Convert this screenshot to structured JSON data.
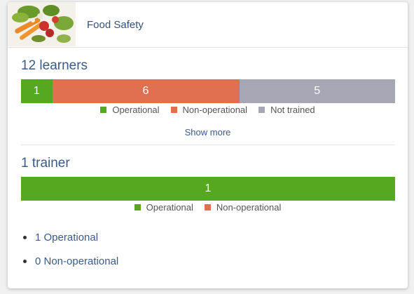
{
  "header": {
    "title": "Food Safety",
    "thumbnail_icon": "vegetables-image"
  },
  "colors": {
    "operational": "#55a820",
    "non_operational": "#e07150",
    "not_trained": "#a6a6b5"
  },
  "learners": {
    "title": "12 learners",
    "bar": [
      {
        "key": "operational",
        "value": 1,
        "label": "1"
      },
      {
        "key": "non_operational",
        "value": 6,
        "label": "6"
      },
      {
        "key": "not_trained",
        "value": 5,
        "label": "5"
      }
    ],
    "legend": [
      {
        "key": "operational",
        "label": "Operational"
      },
      {
        "key": "non_operational",
        "label": "Non-operational"
      },
      {
        "key": "not_trained",
        "label": "Not trained"
      }
    ],
    "show_more": "Show more"
  },
  "trainers": {
    "title": "1 trainer",
    "bar": [
      {
        "key": "operational",
        "value": 1,
        "label": "1"
      }
    ],
    "legend": [
      {
        "key": "operational",
        "label": "Operational"
      },
      {
        "key": "non_operational",
        "label": "Non-operational"
      }
    ],
    "list": [
      {
        "label": "1 Operational"
      },
      {
        "label": "0 Non-operational"
      }
    ]
  }
}
